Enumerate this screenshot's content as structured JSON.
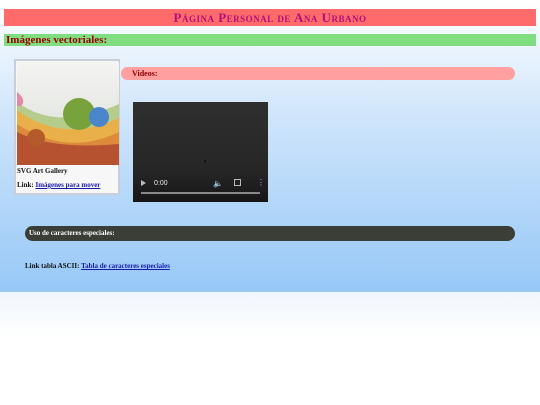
{
  "header": {
    "title": "Página Personal de Ana Urbano"
  },
  "vector_section": {
    "heading": "Imágenes vectoriales:"
  },
  "gallery_card": {
    "caption": "SVG Art Gallery",
    "link_prefix": "Link: ",
    "link_text": "Imágenes para mover"
  },
  "videos_section": {
    "heading": "Videos:"
  },
  "video_player": {
    "time": "0:00",
    "icons": [
      "play-icon",
      "volume-icon",
      "fullscreen-icon",
      "more-options-icon"
    ]
  },
  "special_chars_section": {
    "heading": "Uso de caracteres especiales:"
  },
  "ascii": {
    "link_prefix": "Link tabla ASCII: ",
    "link_text": "Tabla de caracteres especiales"
  },
  "colors": {
    "title_bar": "#ff6b6b",
    "title_text": "#b0107a",
    "green_bar": "#80dd80",
    "videos_bar": "#ff9f9f",
    "special_bar": "#3b3d37",
    "link": "#1a1aa8"
  }
}
